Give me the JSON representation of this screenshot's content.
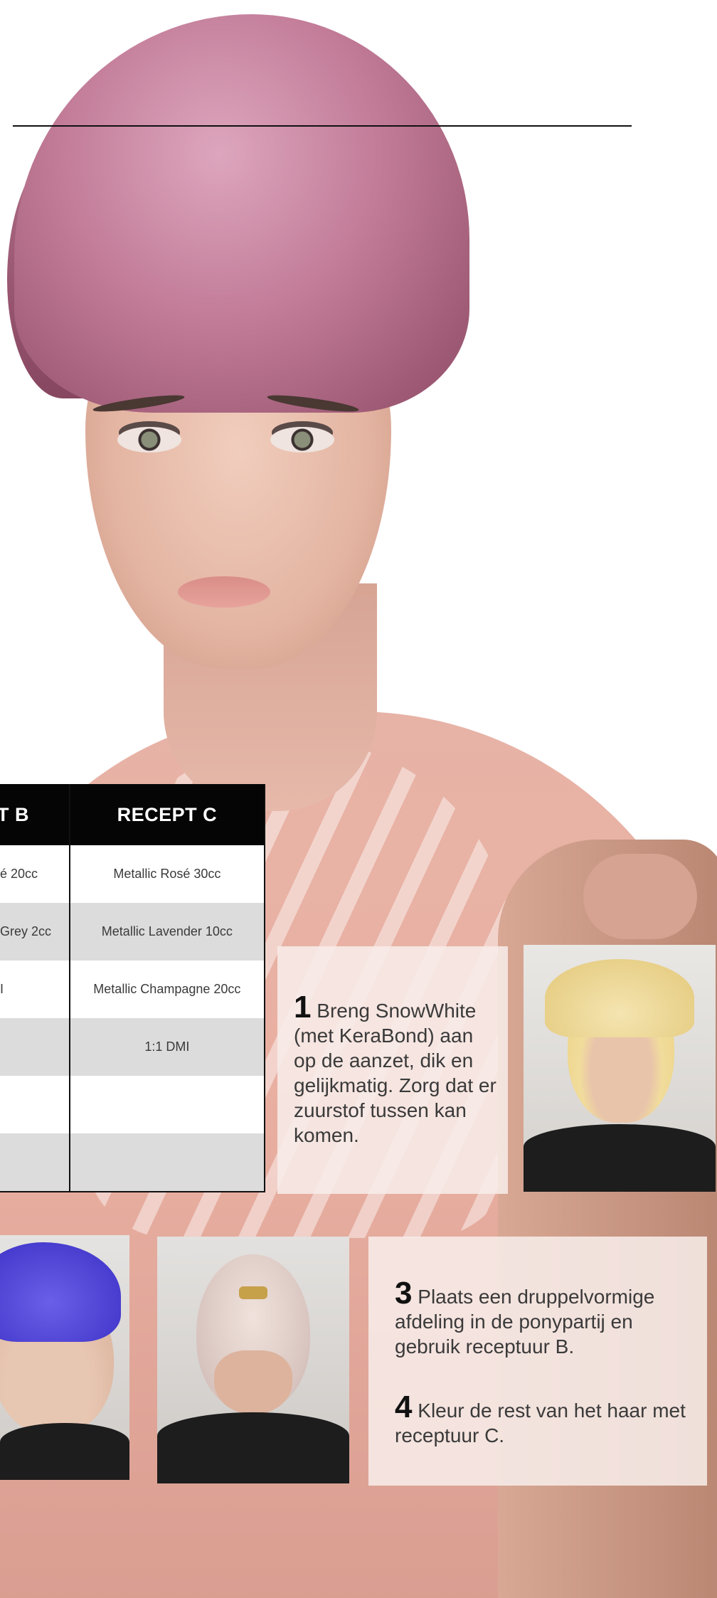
{
  "table": {
    "header_b": "T B",
    "header_c": "RECEPT C",
    "rows": [
      {
        "b": "é 20cc",
        "c": "Metallic Rosé 30cc"
      },
      {
        "b": "Grey 2cc",
        "c": "Metallic Lavender 10cc"
      },
      {
        "b": "I",
        "c": "Metallic Champagne  20cc"
      },
      {
        "b": "",
        "c": "1:1 DMI"
      },
      {
        "b": "",
        "c": ""
      },
      {
        "b": "",
        "c": ""
      }
    ]
  },
  "steps": {
    "step1": {
      "number": "1",
      "text": "Breng SnowWhite (met KeraBond) aan op de aanzet, dik en gelijkmatig. Zorg dat er zuurstof tussen kan komen."
    },
    "step3": {
      "number": "3",
      "text": "Plaats een druppelvormige afdeling in de ponypartij en gebruik receptuur B."
    },
    "step4": {
      "number": "4",
      "text": "Kleur de rest van het haar met receptuur C."
    }
  },
  "colors": {
    "table_header_bg": "#050505",
    "table_stripe": "#dcdcdc",
    "hair_pink": "#c27c98",
    "panel_bg": "#f7ece8",
    "purple_dye": "#4b3fd6"
  }
}
